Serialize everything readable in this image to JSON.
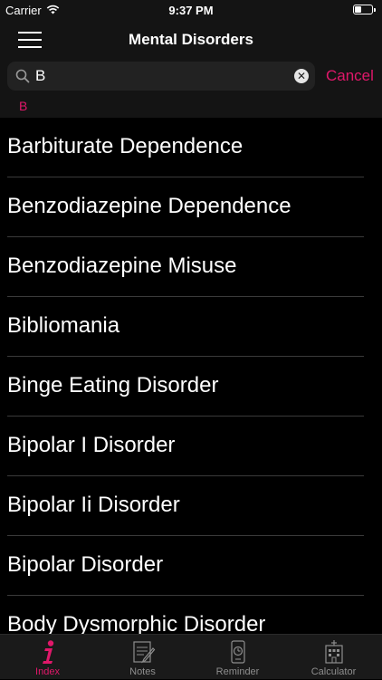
{
  "status_bar": {
    "carrier": "Carrier",
    "time": "9:37 PM"
  },
  "nav": {
    "title": "Mental Disorders"
  },
  "search": {
    "value": "B",
    "cancel_label": "Cancel",
    "scope_letter": "B"
  },
  "results": [
    {
      "label": "Barbiturate Dependence"
    },
    {
      "label": "Benzodiazepine Dependence"
    },
    {
      "label": "Benzodiazepine Misuse"
    },
    {
      "label": "Bibliomania"
    },
    {
      "label": "Binge Eating Disorder"
    },
    {
      "label": "Bipolar I Disorder"
    },
    {
      "label": "Bipolar Ii Disorder"
    },
    {
      "label": "Bipolar Disorder"
    },
    {
      "label": "Body Dysmorphic Disorder"
    }
  ],
  "tabs": [
    {
      "label": "Index",
      "icon": "info-icon",
      "active": true
    },
    {
      "label": "Notes",
      "icon": "notes-icon",
      "active": false
    },
    {
      "label": "Reminder",
      "icon": "reminder-icon",
      "active": false
    },
    {
      "label": "Calculator",
      "icon": "calculator-icon",
      "active": false
    }
  ],
  "colors": {
    "accent": "#e0186a",
    "background": "#000000",
    "bar": "#141414"
  }
}
